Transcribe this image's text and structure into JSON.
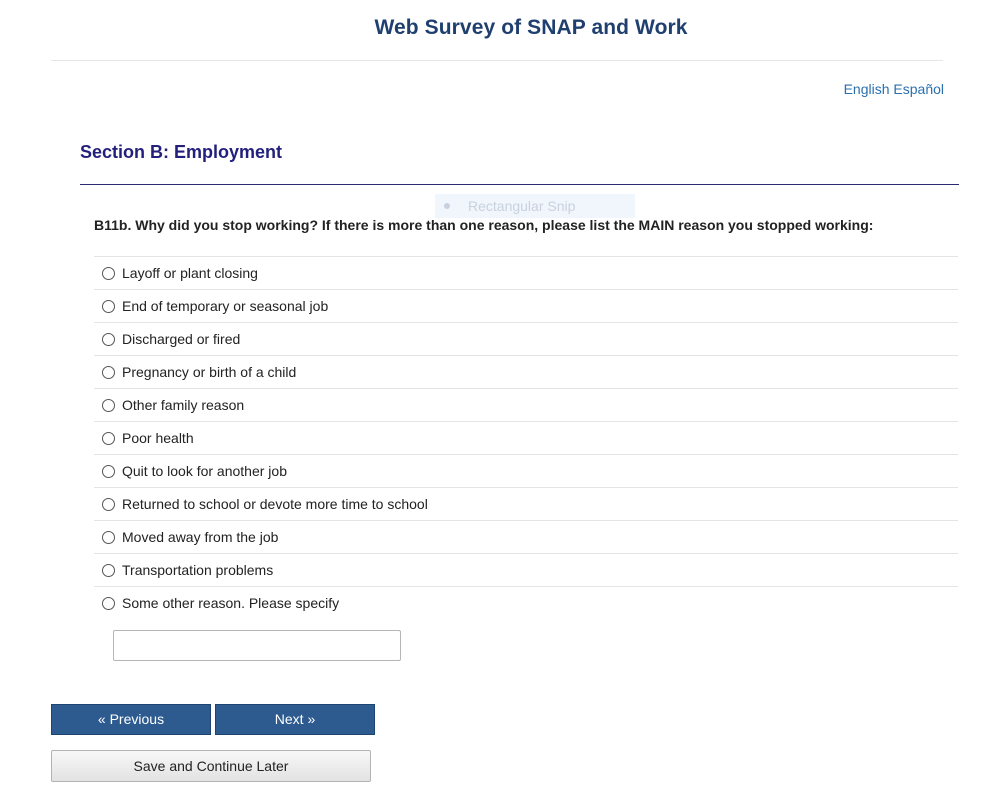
{
  "header": {
    "title": "Web Survey of SNAP and Work"
  },
  "language": {
    "english": "English",
    "spanish": "Español"
  },
  "overlay": {
    "snip_label": "Rectangular Snip"
  },
  "section": {
    "title": "Section B: Employment"
  },
  "question": {
    "text": "B11b. Why did you stop working? If there is more than one reason, please list the MAIN reason you stopped working:",
    "options": [
      "Layoff or plant closing",
      "End of temporary or seasonal job",
      "Discharged or fired",
      "Pregnancy or birth of a child",
      "Other family reason",
      "Poor health",
      "Quit to look for another job",
      "Returned to school or devote more time to school",
      "Moved away from the job",
      "Transportation problems",
      "Some other reason. Please specify"
    ],
    "specify_value": ""
  },
  "buttons": {
    "previous": "« Previous",
    "next": "Next »",
    "save": "Save and Continue Later"
  },
  "colors": {
    "title": "#1f3f6e",
    "section_title": "#231f7c",
    "link": "#2a6fae",
    "nav_button": "#2d5b8f"
  }
}
